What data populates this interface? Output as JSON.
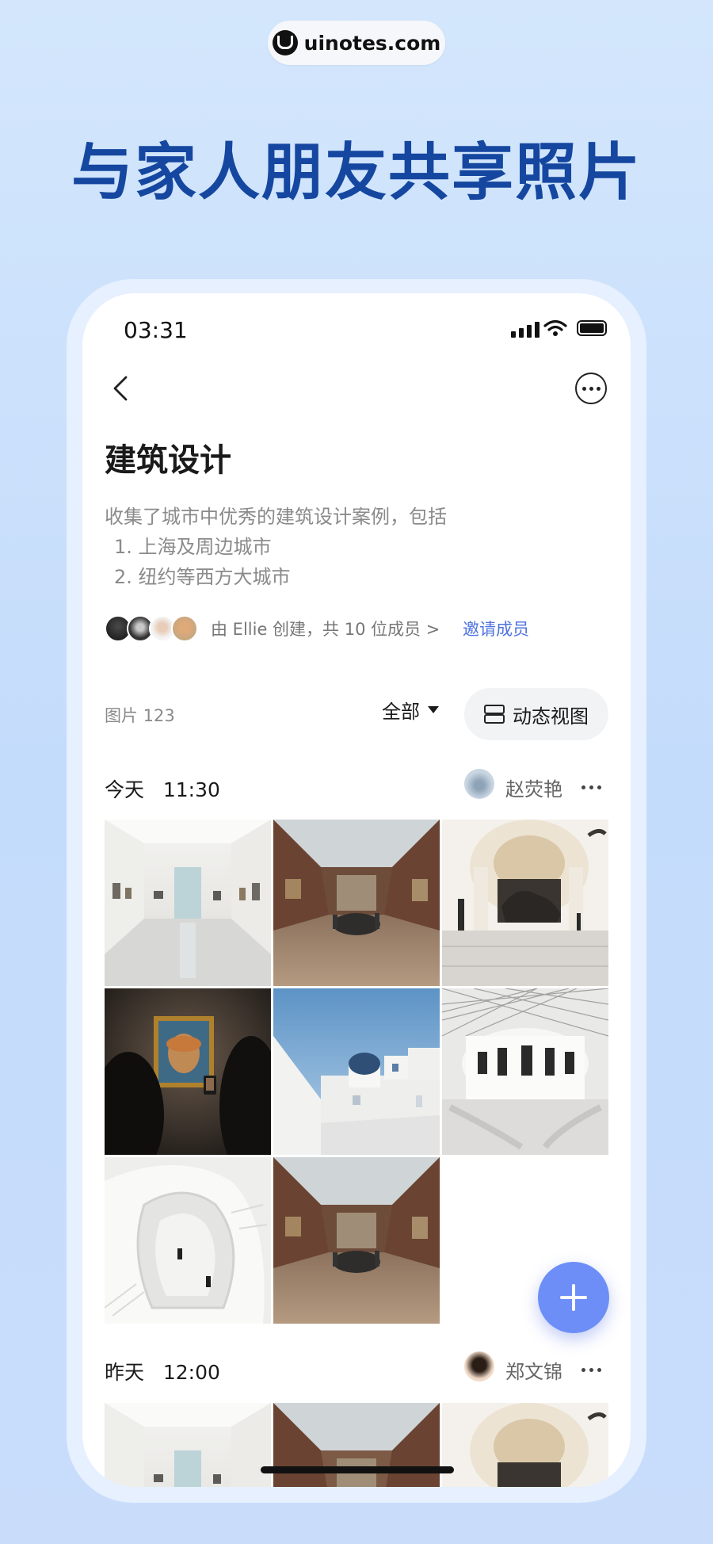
{
  "banner": {
    "brand": "uinotes.com",
    "headline": "与家人朋友共享照片"
  },
  "status_bar": {
    "time": "03:31"
  },
  "album": {
    "title": "建筑设计",
    "description_lines": [
      "收集了城市中优秀的建筑设计案例，包括",
      "1. 上海及周边城市",
      "2. 纽约等西方大城市"
    ],
    "members_text": "由 Ellie 创建，共 10 位成员 >",
    "invite_label": "邀请成员",
    "photo_count": "图片 123",
    "filter_label": "全部",
    "view_mode_label": "动态视图"
  },
  "groups": [
    {
      "date": "今天",
      "time": "11:30",
      "uploader": "赵荧艳",
      "photos": [
        "white-gallery",
        "louvre-hall",
        "natural-history-dome",
        "van-gogh-portrait",
        "santorini-church",
        "british-museum-court",
        "spiral-staircase",
        "louvre-hall"
      ]
    },
    {
      "date": "昨天",
      "time": "12:00",
      "uploader": "郑文锦",
      "photos": [
        "white-gallery",
        "louvre-hall",
        "natural-history-dome"
      ]
    }
  ],
  "icons": {
    "back": "chevron-left-icon",
    "more": "more-circle-icon",
    "add": "plus-icon",
    "view_mode": "layout-rows-icon"
  },
  "colors": {
    "headline": "#1547a0",
    "accent": "#4f73e0",
    "fab": "#6d8ef6",
    "background": "#cfe3fc"
  }
}
